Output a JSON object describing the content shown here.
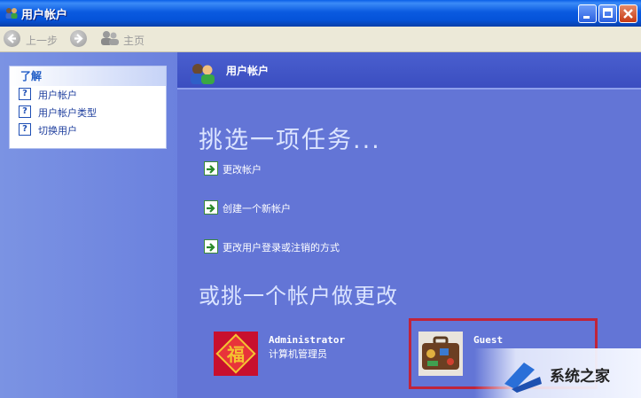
{
  "window": {
    "title": "用户帐户"
  },
  "toolbar": {
    "back_label": "上一步",
    "home_label": "主页"
  },
  "left_pane": {
    "learn_title": "了解",
    "items": [
      {
        "label": "用户帐户",
        "icon": "help-icon"
      },
      {
        "label": "用户帐户类型",
        "icon": "help-icon"
      },
      {
        "label": "切换用户",
        "icon": "help-icon"
      }
    ]
  },
  "main": {
    "header_title": "用户帐户",
    "task_heading": "挑选一项任务...",
    "tasks": [
      {
        "label": "更改帐户",
        "icon": "green-arrow-icon"
      },
      {
        "label": "创建一个新帐户",
        "icon": "green-arrow-icon"
      },
      {
        "label": "更改用户登录或注销的方式",
        "icon": "green-arrow-icon"
      }
    ],
    "pick_heading": "或挑一个帐户做更改",
    "accounts": [
      {
        "name": "Administrator",
        "role": "计算机管理员",
        "icon": "fu-picture-icon"
      },
      {
        "name": "Guest",
        "role": "",
        "icon": "suitcase-icon"
      }
    ]
  },
  "watermark": {
    "text": "系统之家"
  },
  "colors": {
    "accent": "#6375d6",
    "highlight_frame": "#c0243a"
  }
}
